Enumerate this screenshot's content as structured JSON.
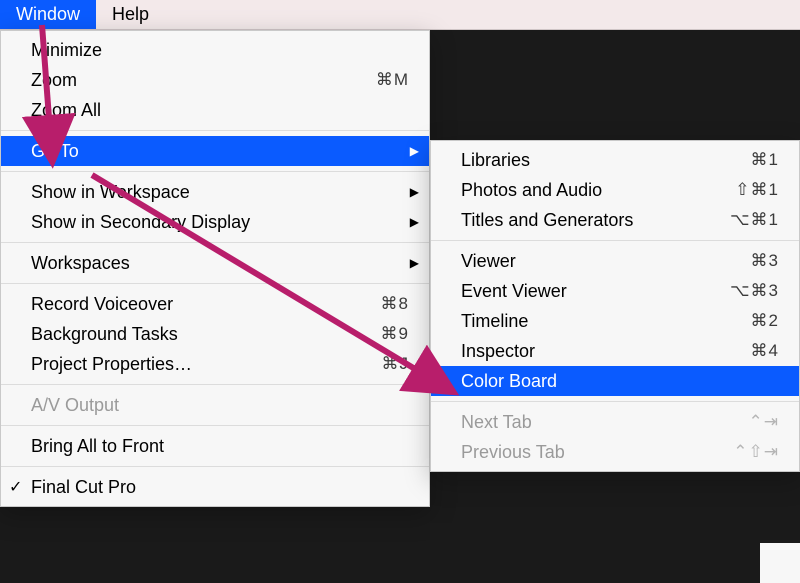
{
  "menubar": {
    "window": "Window",
    "help": "Help"
  },
  "main_menu": {
    "minimize": "Minimize",
    "zoom": "Zoom",
    "zoom_short": "⌘M",
    "zoom_all": "Zoom All",
    "go_to": "Go To",
    "show_workspace": "Show in Workspace",
    "show_secondary": "Show in Secondary Display",
    "workspaces": "Workspaces",
    "record_voiceover": "Record Voiceover",
    "record_voiceover_short": "⌘8",
    "background_tasks": "Background Tasks",
    "background_tasks_short": "⌘9",
    "project_properties": "Project Properties…",
    "project_properties_short": "⌘J",
    "av_output": "A/V Output",
    "bring_all_to_front": "Bring All to Front",
    "fcp": "Final Cut Pro"
  },
  "sub_menu": {
    "libraries": "Libraries",
    "libraries_short": "⌘1",
    "photos_audio": "Photos and Audio",
    "photos_audio_short": "⇧⌘1",
    "titles_generators": "Titles and Generators",
    "titles_generators_short": "⌥⌘1",
    "viewer": "Viewer",
    "viewer_short": "⌘3",
    "event_viewer": "Event Viewer",
    "event_viewer_short": "⌥⌘3",
    "timeline": "Timeline",
    "timeline_short": "⌘2",
    "inspector": "Inspector",
    "inspector_short": "⌘4",
    "color_board": "Color Board",
    "next_tab": "Next Tab",
    "next_tab_short": "⌃⇥",
    "prev_tab": "Previous Tab",
    "prev_tab_short": "⌃⇧⇥"
  },
  "annotation": {
    "arrow_color": "#b81e6b"
  }
}
